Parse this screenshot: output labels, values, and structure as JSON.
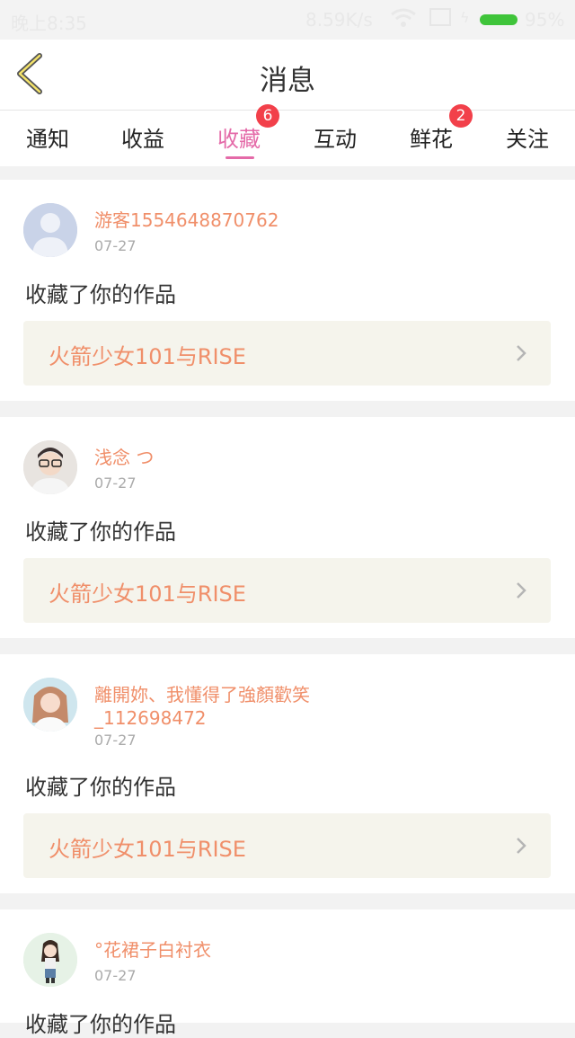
{
  "status_bar": {
    "time": "晚上8:35",
    "network_speed": "8.59K/s",
    "battery": "95%",
    "battery_color": "#3fc43a"
  },
  "header": {
    "title": "消息",
    "back_icon": "chevron-left-icon"
  },
  "tabs": [
    {
      "label": "通知",
      "badge": null,
      "active": false
    },
    {
      "label": "收益",
      "badge": null,
      "active": false
    },
    {
      "label": "收藏",
      "badge": "6",
      "active": true
    },
    {
      "label": "互动",
      "badge": null,
      "active": false
    },
    {
      "label": "鲜花",
      "badge": "2",
      "active": false
    },
    {
      "label": "关注",
      "badge": null,
      "active": false
    }
  ],
  "messages": [
    {
      "user": "游客1554648870762",
      "date": "07-27",
      "action": "收藏了你的作品",
      "work": "火箭少女101与RISE"
    },
    {
      "user": "浅念 つ",
      "date": "07-27",
      "action": "收藏了你的作品",
      "work": "火箭少女101与RISE"
    },
    {
      "user": "離開妳、我懂得了強顏歡笑_112698472",
      "date": "07-27",
      "action": "收藏了你的作品",
      "work": "火箭少女101与RISE"
    },
    {
      "user": "°花裙子白衬衣",
      "date": "07-27",
      "action": "收藏了你的作品"
    }
  ],
  "colors": {
    "accent": "#e46aa8",
    "username": "#f08f6a",
    "badge": "#f2404a",
    "work_box": "#f5f4ec"
  }
}
